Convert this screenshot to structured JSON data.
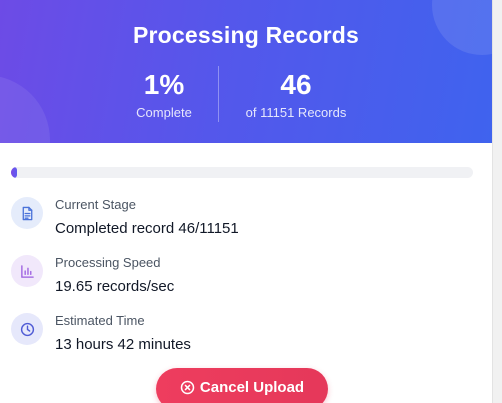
{
  "header": {
    "title": "Processing Records",
    "percent": "1%",
    "percent_label": "Complete",
    "count": "46",
    "count_label": "of 11151 Records"
  },
  "progress": {
    "fraction": 0.0041,
    "color": "#7c4be6"
  },
  "rows": [
    {
      "label": "Current Stage",
      "value": "Completed record 46/11151",
      "icon": "document-icon",
      "color": "#4a72d9"
    },
    {
      "label": "Processing Speed",
      "value": "19.65 records/sec",
      "icon": "bar-chart-icon",
      "color": "#9b5de0"
    },
    {
      "label": "Estimated Time",
      "value": "13 hours 42 minutes",
      "icon": "clock-icon",
      "color": "#4f5bd5"
    }
  ],
  "cancel": {
    "label": "Cancel Upload",
    "icon": "close-circle-icon",
    "color": "#ee3d5e"
  }
}
